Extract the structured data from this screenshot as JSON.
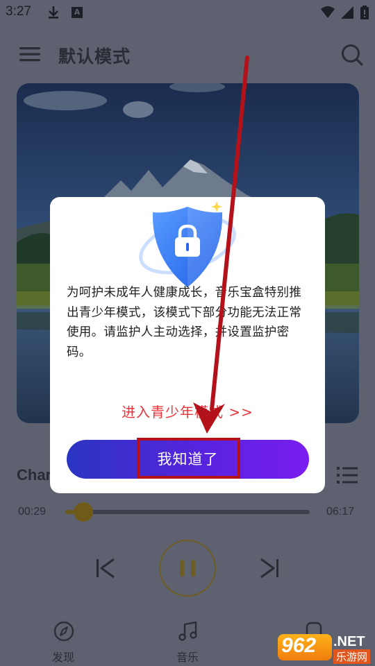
{
  "status_bar": {
    "time": "3:27",
    "icons": [
      "download-icon",
      "a-notification-icon",
      "wifi-icon",
      "signal-icon",
      "battery-icon"
    ]
  },
  "header": {
    "title": "默认模式",
    "menu_icon": "hamburger-menu-icon",
    "search_icon": "search-icon"
  },
  "player": {
    "song_title": "Char",
    "time_elapsed": "00:29",
    "time_total": "06:17",
    "progress": 0.077,
    "playlist_icon": "playlist-icon",
    "prev_icon": "skip-previous-icon",
    "pause_icon": "pause-icon",
    "next_icon": "skip-next-icon"
  },
  "bottom_nav": {
    "items": [
      {
        "label": "发现",
        "icon": "compass-icon"
      },
      {
        "label": "音乐",
        "icon": "music-note-icon"
      },
      {
        "label": "",
        "icon": "rank-icon"
      }
    ]
  },
  "dialog": {
    "message": "为呵护未成年人健康成长，音乐宝盒特别推出青少年模式，该模式下部分功能无法正常使用。请监护人主动选择，并设置监护密码。",
    "link_label": "进入青少年模式 >>",
    "confirm_label": "我知道了",
    "illustration": "shield-lock-icon"
  },
  "watermark": {
    "number": "962",
    "suffix": ".NET",
    "site": "乐游网"
  },
  "colors": {
    "accent_gold": "#6e5b1a",
    "link_red": "#e8343a",
    "button_gradient_start": "#2b35c2",
    "button_gradient_end": "#7a1ef0",
    "annotation_red": "#b3121b"
  }
}
